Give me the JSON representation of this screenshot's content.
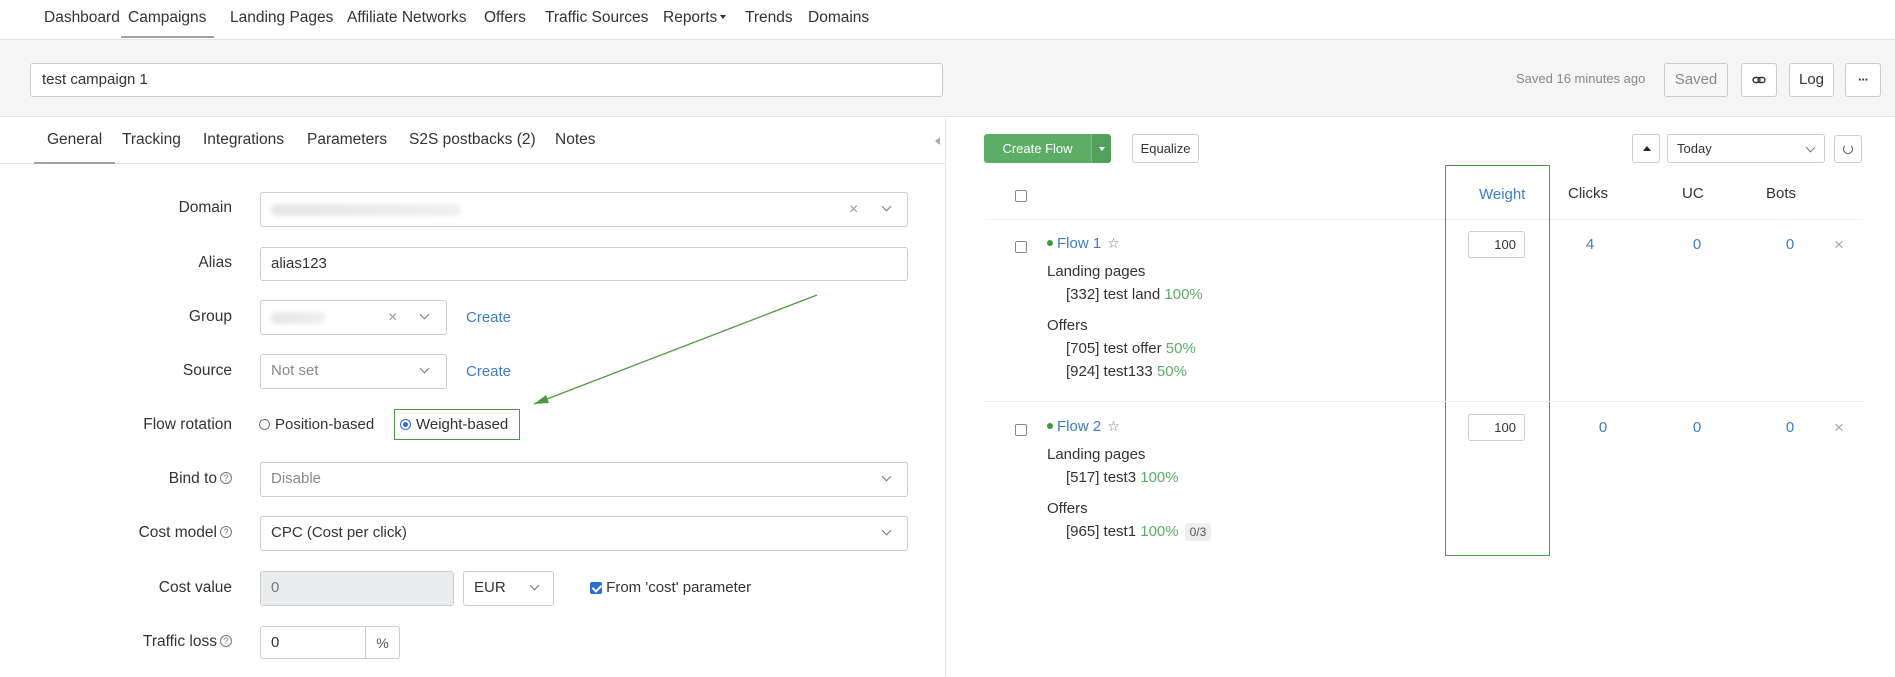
{
  "nav": {
    "items": [
      "Dashboard",
      "Campaigns",
      "Landing Pages",
      "Affiliate Networks",
      "Offers",
      "Traffic Sources",
      "Reports",
      "Trends",
      "Domains"
    ],
    "active": "Campaigns"
  },
  "header": {
    "campaign_name": "test campaign 1",
    "saved_text": "Saved 16 minutes ago",
    "saved_button": "Saved",
    "log_button": "Log",
    "more_button": "···",
    "link_icon": "link-icon"
  },
  "tabs": [
    "General",
    "Tracking",
    "Integrations",
    "Parameters",
    "S2S postbacks (2)",
    "Notes"
  ],
  "form": {
    "domain_label": "Domain",
    "alias_label": "Alias",
    "alias_value": "alias123",
    "group_label": "Group",
    "group_create": "Create",
    "source_label": "Source",
    "source_value": "Not set",
    "source_create": "Create",
    "flow_rotation_label": "Flow rotation",
    "rotation_options": [
      "Position-based",
      "Weight-based"
    ],
    "rotation_selected": "Weight-based",
    "bind_to_label": "Bind to",
    "bind_to_value": "Disable",
    "cost_model_label": "Cost model",
    "cost_model_value": "CPC (Cost per click)",
    "cost_value_label": "Cost value",
    "cost_value": "0",
    "currency": "EUR",
    "from_cost_label": "From 'cost' parameter",
    "from_cost_checked": true,
    "traffic_loss_label": "Traffic loss",
    "traffic_loss_value": "0",
    "traffic_loss_unit": "%",
    "help_icon": "?"
  },
  "flows_toolbar": {
    "create_flow": "Create Flow",
    "equalize": "Equalize",
    "period": "Today"
  },
  "flows_table": {
    "columns": [
      "Weight",
      "Clicks",
      "UC",
      "Bots"
    ],
    "landing_pages_label": "Landing pages",
    "offers_label": "Offers",
    "rows": [
      {
        "name": "Flow 1",
        "weight": "100",
        "clicks": "4",
        "uc": "0",
        "bots": "0",
        "landing_pages": [
          {
            "name": "[332] test land",
            "pct": "100%"
          }
        ],
        "offers": [
          {
            "name": "[705] test offer",
            "pct": "50%",
            "badge": ""
          },
          {
            "name": "[924] test133",
            "pct": "50%",
            "badge": ""
          }
        ]
      },
      {
        "name": "Flow 2",
        "weight": "100",
        "clicks": "0",
        "uc": "0",
        "bots": "0",
        "landing_pages": [
          {
            "name": "[517] test3",
            "pct": "100%"
          }
        ],
        "offers": [
          {
            "name": "[965] test1",
            "pct": "100%",
            "badge": "0/3"
          }
        ]
      }
    ]
  },
  "colors": {
    "accent_blue": "#3d7cc9",
    "green_button": "#5cae67",
    "highlight_green": "#4a9a3f"
  }
}
